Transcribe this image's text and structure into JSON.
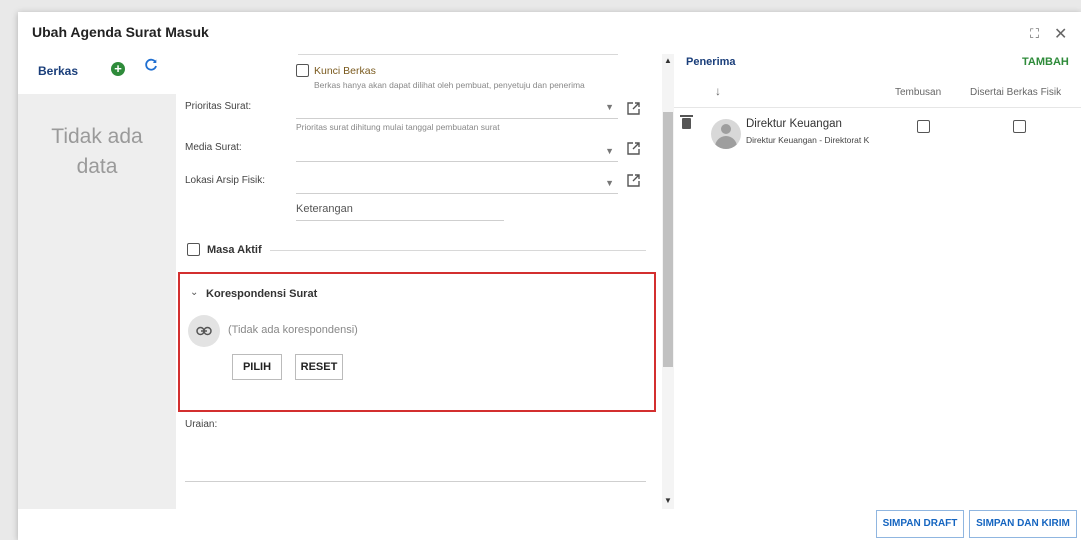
{
  "dialog": {
    "title": "Ubah Agenda Surat Masuk",
    "maximize_glyph": "⛶",
    "close_glyph": "✕"
  },
  "berkas": {
    "title": "Berkas",
    "add_glyph": "+",
    "refresh_glyph": "C",
    "empty_line1": "Tidak ada",
    "empty_line2": "data"
  },
  "form": {
    "kunci_label": "Kunci Berkas",
    "kunci_hint": "Berkas hanya akan dapat dilihat oleh pembuat, penyetuju dan penerima",
    "prioritas_label": "Prioritas Surat:",
    "prioritas_hint": "Prioritas surat dihitung mulai tanggal pembuatan surat",
    "media_label": "Media Surat:",
    "lokasi_label": "Lokasi Arsip Fisik:",
    "keterangan_placeholder": "Keterangan",
    "masa_aktif_label": "Masa Aktif",
    "uraian_label": "Uraian:"
  },
  "korespondensi": {
    "title": "Korespondensi Surat",
    "empty_text": "(Tidak ada korespondensi)",
    "pilih_label": "PILIH",
    "reset_label": "RESET",
    "highlight_color": "#d32f2f"
  },
  "penerima": {
    "title": "Penerima",
    "tambah_label": "TAMBAH",
    "sort_glyph": "↓",
    "col_tembusan": "Tembusan",
    "col_disertai": "Disertai Berkas Fisik",
    "rows": [
      {
        "name": "Direktur Keuangan",
        "subtitle": "Direktur Keuangan - Direktorat K"
      }
    ]
  },
  "actions": {
    "simpan_draft": "SIMPAN DRAFT",
    "simpan_kirim": "SIMPAN DAN KIRIM"
  },
  "colors": {
    "accent_blue": "#1565c0",
    "accent_green": "#2e8b3a",
    "heading_blue": "#1a3e7a"
  }
}
